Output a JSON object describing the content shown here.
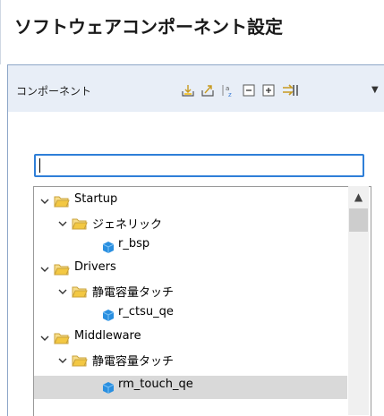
{
  "window": {
    "title": "ソフトウェアコンポーネント設定"
  },
  "panel": {
    "title": "コンポーネント",
    "toolbar_icons": [
      "import-icon",
      "export-icon",
      "sort-icon",
      "collapse-all-icon",
      "expand-all-icon",
      "link-icon",
      "view-menu-icon"
    ],
    "add_icon": "add-component-icon",
    "remove_icon": "remove-component-icon"
  },
  "search": {
    "value": "",
    "placeholder": ""
  },
  "tree": {
    "items": [
      {
        "label": "Startup",
        "type": "folder",
        "level": 0,
        "expanded": true
      },
      {
        "label": "ジェネリック",
        "type": "folder",
        "level": 1,
        "expanded": true
      },
      {
        "label": "r_bsp",
        "type": "component",
        "level": 2
      },
      {
        "label": "Drivers",
        "type": "folder",
        "level": 0,
        "expanded": true
      },
      {
        "label": "静電容量タッチ",
        "type": "folder",
        "level": 1,
        "expanded": true
      },
      {
        "label": "r_ctsu_qe",
        "type": "component",
        "level": 2
      },
      {
        "label": "Middleware",
        "type": "folder",
        "level": 0,
        "expanded": true
      },
      {
        "label": "静電容量タッチ",
        "type": "folder",
        "level": 1,
        "expanded": true
      },
      {
        "label": "rm_touch_qe",
        "type": "component",
        "level": 2,
        "selected": true
      }
    ]
  },
  "colors": {
    "header_bg": "#e8eef7",
    "folder_yellow": "#f3c843",
    "component_blue": "#2a8fe0",
    "selection_gray": "#d9d9d9",
    "focus_blue": "#2f7fd8"
  }
}
